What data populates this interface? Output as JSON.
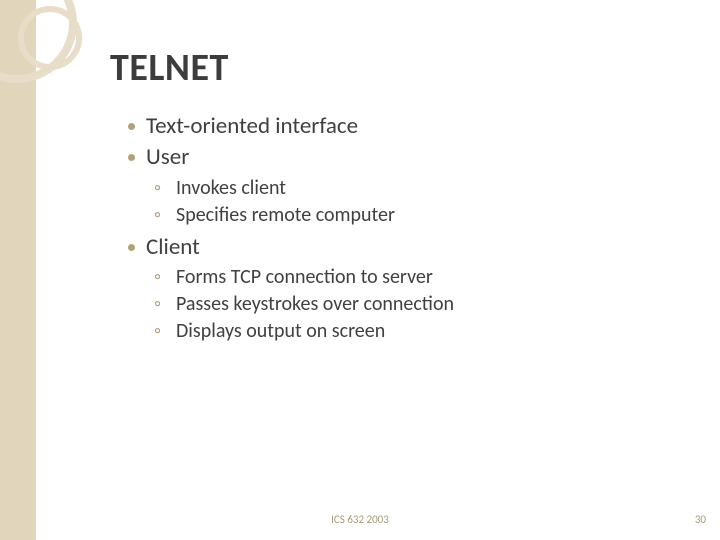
{
  "title": "TELNET",
  "bullets": {
    "b1": "Text-oriented interface",
    "b2": "User",
    "b2_1": "Invokes client",
    "b2_2": "Specifies remote computer",
    "b3": "Client",
    "b3_1": "Forms TCP connection to server",
    "b3_2": "Passes keystrokes over connection",
    "b3_3": "Displays output on screen"
  },
  "footer": {
    "center": "ICS 632 2003",
    "page": "30"
  }
}
